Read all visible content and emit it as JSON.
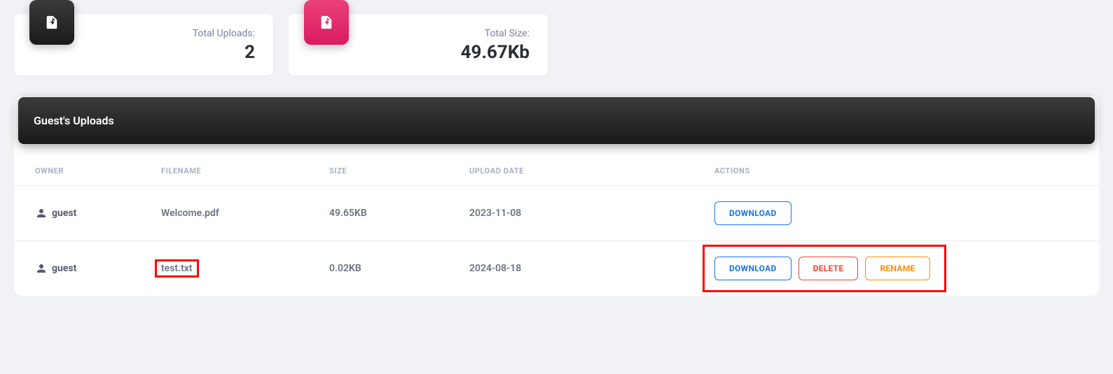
{
  "stats": {
    "uploads": {
      "label": "Total Uploads:",
      "value": "2"
    },
    "size": {
      "label": "Total Size:",
      "value": "49.67Kb"
    }
  },
  "panel": {
    "title": "Guest's Uploads"
  },
  "headers": {
    "owner": "OWNER",
    "filename": "FILENAME",
    "size": "SIZE",
    "upload_date": "UPLOAD DATE",
    "actions": "ACTIONS"
  },
  "rows": [
    {
      "owner": "guest",
      "filename": "Welcome.pdf",
      "size": "49.65KB",
      "date": "2023-11-08",
      "highlighted": false,
      "actions": {
        "download": "DOWNLOAD"
      }
    },
    {
      "owner": "guest",
      "filename": "test.txt",
      "size": "0.02KB",
      "date": "2024-08-18",
      "highlighted": true,
      "actions": {
        "download": "DOWNLOAD",
        "delete": "DELETE",
        "rename": "RENAME"
      }
    }
  ]
}
